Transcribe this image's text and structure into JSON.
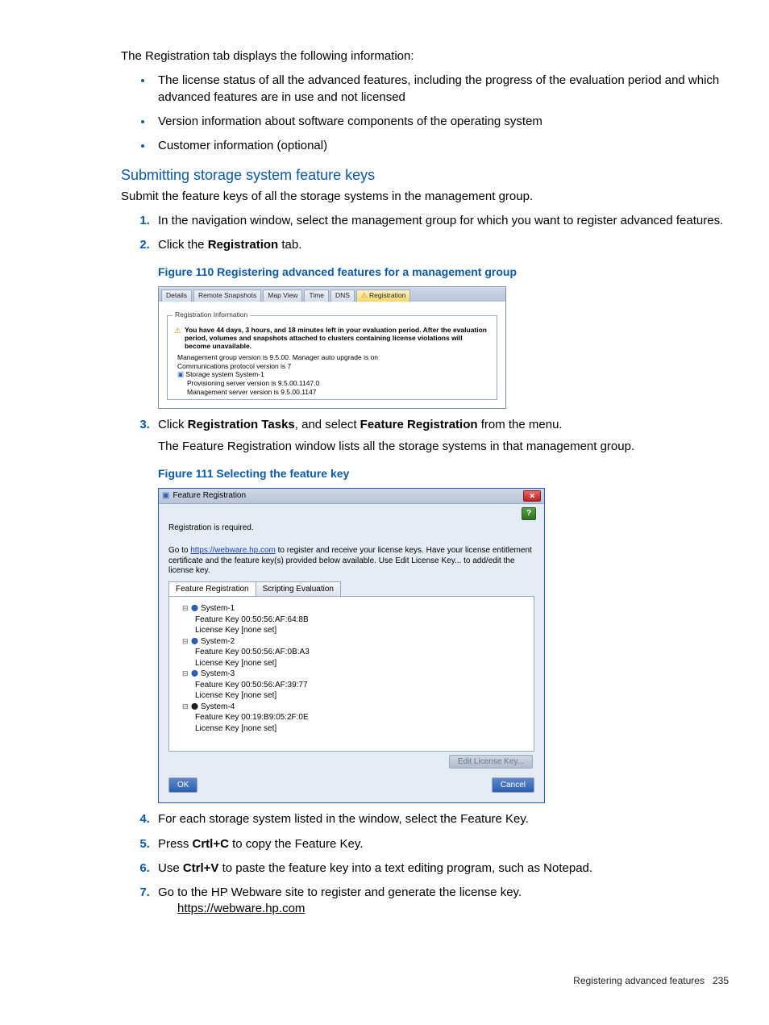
{
  "intro": "The Registration tab displays the following information:",
  "bullets": [
    "The license status of all the advanced features, including the progress of the evaluation period and which advanced features are in use and not licensed",
    "Version information about software components of the operating system",
    "Customer information (optional)"
  ],
  "section_heading": "Submitting storage system feature keys",
  "section_intro": "Submit the feature keys of all the storage systems in the management group.",
  "steps_a": {
    "s1": "In the navigation window, select the management group for which you want to register advanced features.",
    "s2_pre": "Click the ",
    "s2_bold": "Registration",
    "s2_post": " tab."
  },
  "fig110_caption": "Figure 110 Registering advanced features for a management group",
  "fig110": {
    "tabs": [
      "Details",
      "Remote Snapshots",
      "Map View",
      "Time",
      "DNS",
      "Registration"
    ],
    "group_label": "Registration Information",
    "warn": "You have 44 days, 3 hours, and 18 minutes left in your evaluation period. After the evaluation period, volumes and snapshots attached to clusters containing license violations will become unavailable.",
    "lines": {
      "l1": "Management group version is 9.5.00. Manager auto upgrade is on",
      "l2": "Communications protocol version is 7",
      "l3": "Storage system System-1",
      "l4": "Provisioning server version is 9.5.00.1147.0",
      "l5": "Management server version is 9.5.00.1147"
    }
  },
  "step3": {
    "pre": "Click ",
    "bold1": "Registration Tasks",
    "mid": ", and select ",
    "bold2": "Feature Registration",
    "post": " from the menu.",
    "line2": "The Feature Registration window lists all the storage systems in that management group."
  },
  "fig111_caption": "Figure 111 Selecting the feature key",
  "fig111": {
    "title": "Feature Registration",
    "close": "✕",
    "help": "?",
    "req": "Registration is required.",
    "para_pre": "Go to ",
    "para_url": "https://webware.hp.com",
    "para_post": " to register and receive your license keys. Have your license entitlement certificate and the feature key(s) provided below available. Use Edit License Key... to add/edit the license key.",
    "tabs": {
      "t1": "Feature Registration",
      "t2": "Scripting Evaluation"
    },
    "systems": [
      {
        "name": "System-1",
        "feature": "Feature Key 00:50:56:AF:64:8B",
        "license": "License Key [none set]"
      },
      {
        "name": "System-2",
        "feature": "Feature Key 00:50:56:AF:0B:A3",
        "license": "License Key [none set]"
      },
      {
        "name": "System-3",
        "feature": "Feature Key 00:50:56:AF:39:77",
        "license": "License Key [none set]"
      },
      {
        "name": "System-4",
        "feature": "Feature Key 00:19:B9:05:2F:0E",
        "license": "License Key [none set]",
        "dark": true
      }
    ],
    "edit_btn": "Edit License Key...",
    "ok": "OK",
    "cancel": "Cancel"
  },
  "steps_b": {
    "s4": "For each storage system listed in the window, select the Feature Key.",
    "s5_pre": "Press ",
    "s5_bold": "Crtl+C",
    "s5_post": " to copy the Feature Key.",
    "s6_pre": "Use ",
    "s6_bold": "Ctrl+V",
    "s6_post": " to paste the feature key into a text editing program, such as Notepad.",
    "s7_line": "Go to the HP Webware site to register and generate the license key.",
    "s7_url": "https://webware.hp.com"
  },
  "footer": {
    "label": "Registering advanced features",
    "page": "235"
  }
}
